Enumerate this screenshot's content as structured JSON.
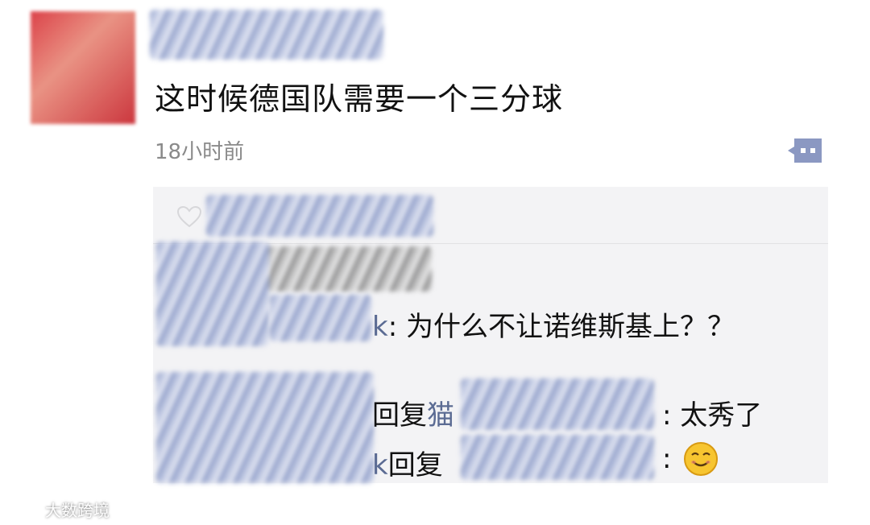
{
  "post": {
    "text": "这时候德国队需要一个三分球",
    "timestamp": "18小时前"
  },
  "icons": {
    "comment": "comment-bubble-icon",
    "like": "heart-outline-icon",
    "emoji": "grinning-face-emoji-icon",
    "watermark_logo": "weibo-logo-icon"
  },
  "comments": [
    {
      "name_fragment": "k",
      "text": ": 为什么不让诺维斯基上？？"
    },
    {
      "reply_label": "回复",
      "name_fragment": "猫",
      "separator": ":",
      "text": "太秀了"
    },
    {
      "name_fragment": "k",
      "reply_label": "回复",
      "separator": ":"
    }
  ],
  "watermark": {
    "text": "大数跨境"
  },
  "colors": {
    "link_name": "#5b6b93",
    "panel_bg": "#f3f3f5",
    "icon_blue": "#8b98c2"
  }
}
